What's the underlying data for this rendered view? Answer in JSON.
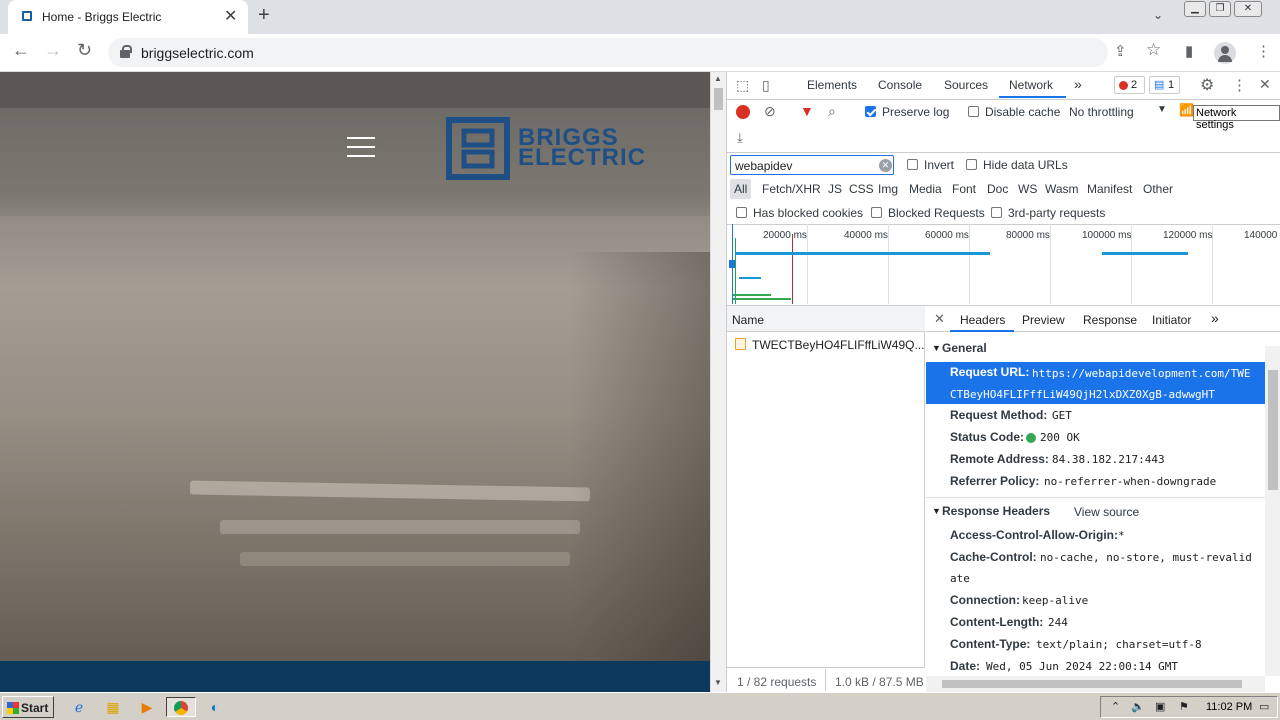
{
  "browser": {
    "tab_title": "Home - Briggs Electric",
    "url": "briggselectric.com",
    "new_tab": "+",
    "close_tab": "✕"
  },
  "site": {
    "logo_line1": "BRIGGS",
    "logo_line2": "ELECTRIC",
    "brand_color": "#1e4f85"
  },
  "devtools": {
    "tabs": [
      "Elements",
      "Console",
      "Sources",
      "Network"
    ],
    "active_tab": "Network",
    "errors_count": "2",
    "messages_count": "1",
    "preserve_log": "Preserve log",
    "disable_cache": "Disable cache",
    "throttling": "No throttling",
    "network_settings_tooltip": "Network settings",
    "filter_value": "webapidev",
    "invert": "Invert",
    "hide_data_urls": "Hide data URLs",
    "filter_types": [
      "All",
      "Fetch/XHR",
      "JS",
      "CSS",
      "Img",
      "Media",
      "Font",
      "Doc",
      "WS",
      "Wasm",
      "Manifest",
      "Other"
    ],
    "has_blocked_cookies": "Has blocked cookies",
    "blocked_requests": "Blocked Requests",
    "third_party": "3rd-party requests",
    "timeline_ticks": [
      "20000 ms",
      "40000 ms",
      "60000 ms",
      "80000 ms",
      "100000 ms",
      "120000 ms",
      "140000"
    ],
    "name_header": "Name",
    "request_name": "TWECTBeyHO4FLIFffLiW49Q...",
    "footer_requests": "1 / 82 requests",
    "footer_size": "1.0 kB / 87.5 MB",
    "detail_tabs": [
      "Headers",
      "Preview",
      "Response",
      "Initiator"
    ],
    "general_title": "General",
    "request_url_key": "Request URL:",
    "request_url_line1": "https://webapidevelopment.com/TWE",
    "request_url_line2": "CTBeyHO4FLIFffLiW49QjH2lxDXZ0XgB-adwwgHT",
    "request_method_key": "Request Method:",
    "request_method": "GET",
    "status_code_key": "Status Code:",
    "status_code": "200 OK",
    "remote_address_key": "Remote Address:",
    "remote_address": "84.38.182.217:443",
    "referrer_policy_key": "Referrer Policy:",
    "referrer_policy": "no-referrer-when-downgrade",
    "response_headers_title": "Response Headers",
    "view_source": "View source",
    "acao_key": "Access-Control-Allow-Origin:",
    "acao": "*",
    "cache_control_key": "Cache-Control:",
    "cache_control_line1": "no-cache, no-store, must-revalid",
    "cache_control_line2": "ate",
    "connection_key": "Connection:",
    "connection": "keep-alive",
    "content_length_key": "Content-Length:",
    "content_length": "244",
    "content_type_key": "Content-Type:",
    "content_type": "text/plain; charset=utf-8",
    "date_key": "Date:",
    "date": "Wed, 05 Jun 2024 22:00:14 GMT"
  },
  "taskbar": {
    "start": "Start",
    "clock": "11:02 PM"
  },
  "colors": {
    "accent": "#1a73e8",
    "record": "#d93025",
    "selected_row": "#1a73e8"
  }
}
